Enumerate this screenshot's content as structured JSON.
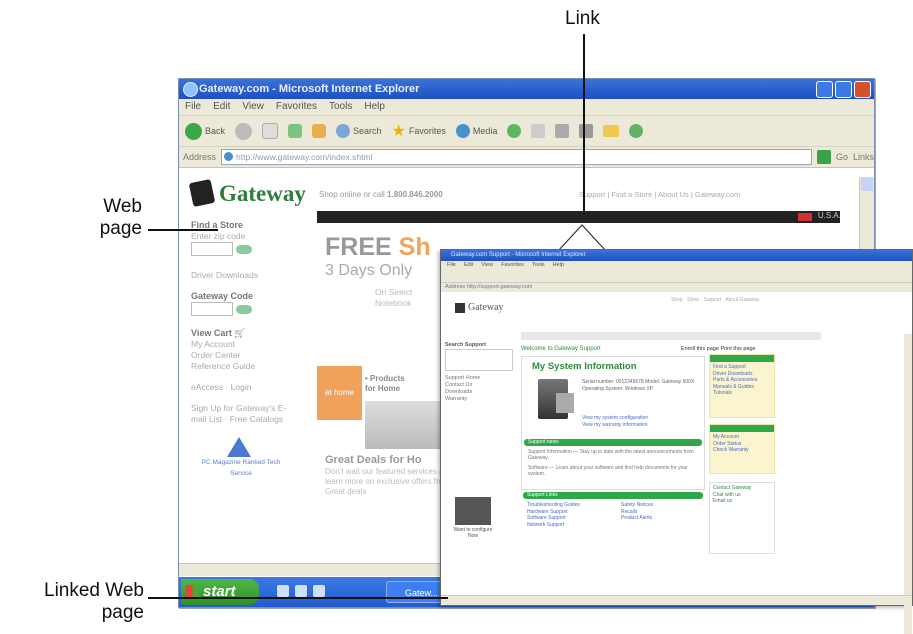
{
  "callouts": {
    "link": "Link",
    "web_page_line1": "Web",
    "web_page_line2": "page",
    "linked_line1": "Linked Web",
    "linked_line2": "page"
  },
  "main_window": {
    "title": "Gateway.com - Microsoft Internet Explorer",
    "menu": [
      "File",
      "Edit",
      "View",
      "Favorites",
      "Tools",
      "Help"
    ],
    "toolbar": {
      "back": "Back",
      "search": "Search",
      "favorites": "Favorites",
      "media": "Media"
    },
    "address_label": "Address",
    "address_value": "http://www.gateway.com/index.shtml",
    "go_label": "Go",
    "links_label": "Links",
    "page": {
      "logo": "Gateway",
      "tagline_pre": "Shop online or call ",
      "tagline_phone": "1.800.846.2000",
      "top_links": "Support | Find a Store | About Us | Gateway.com",
      "left_nav": {
        "find_store": "Find a Store",
        "enter_zip": "Enter zip code",
        "driver_downloads": "Driver Downloads",
        "gateway_code": "Gateway Code",
        "view_cart": "View Cart",
        "my_account": "My Account",
        "order_center": "Order Center",
        "reference_guide": "Reference Guide",
        "log": "eAccess · Login",
        "signup": "Sign Up for Gateway's E-mail List · Free Catalogs",
        "badge": "PC Magazine Ranked Tech Service"
      },
      "promo": {
        "region": "U.S.A.",
        "free": "FREE",
        "free_tail": "Sh",
        "days": "3 Days Only",
        "on_select": "On Select",
        "notebooks": "Notebook",
        "at_home": "at home",
        "products": "• Products",
        "for_home": "for Home",
        "great_deals": "Great Deals for Ho",
        "great_body": "Don't wait our featured services and learn more on exclusive offers from Great deals"
      }
    },
    "taskbar": {
      "start": "start",
      "task": "Gatew..."
    }
  },
  "linked_window": {
    "title": "Gateway.com Support - Microsoft Internet Explorer",
    "menu": [
      "File",
      "Edit",
      "View",
      "Favorites",
      "Tools",
      "Help"
    ],
    "address": "Address  http://support.gateway.com",
    "logo": "Gateway",
    "top_links": "Shop · Store · Support · About Gateway",
    "welcome": "Welcome to Gateway Support",
    "header_links": "Enroll this page   Print this page",
    "side": [
      "Search Support",
      "Support Home",
      "Contact Us",
      "Downloads",
      "Warranty"
    ],
    "photo_caption": "Want to configure Now",
    "system_info": {
      "heading": "My System Information",
      "info": "Serial number: 0012345678 Model: Gateway 500X Operating System: Windows XP",
      "link1": "View my system configuration",
      "link2": "View my warranty information"
    },
    "sections": {
      "support_news": "Support news",
      "news_body1": "Support Information — Stay up to date with the latest announcements from Gateway.",
      "news_body2": "Software — Learn about your software and find help documents for your system.",
      "support_links": "Support Links"
    },
    "right_boxes": {
      "box1": [
        "Find a Support",
        "Driver Downloads",
        "Parts & Accessories",
        "Manuals & Guides",
        "Tutorials"
      ],
      "box2": [
        "My Account",
        "Order Status",
        "Check Warranty"
      ],
      "box3": [
        "Contact Gateway",
        "Chat with us",
        "Email us"
      ]
    },
    "links_a": [
      "Troubleshooting Guides",
      "Hardware Support",
      "Software Support",
      "Network Support"
    ],
    "links_b": [
      "Safety Notices",
      "Recalls",
      "Product Alerts"
    ]
  }
}
